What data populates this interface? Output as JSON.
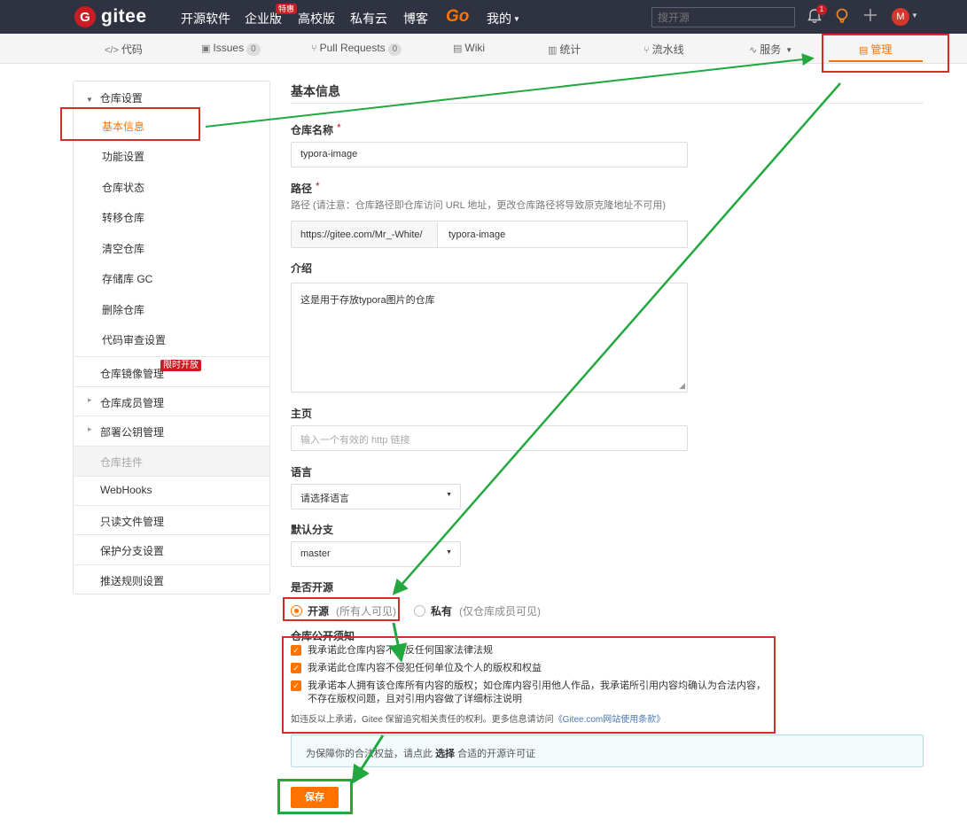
{
  "topnav": {
    "logo_letter": "G",
    "logo_text": "gitee",
    "links": [
      "开源软件",
      "企业版",
      "高校版",
      "私有云",
      "博客"
    ],
    "hot_badge": "特惠",
    "go_label": "Go",
    "mine_label": "我的",
    "search_placeholder": "搜开源",
    "notification_count": "1",
    "avatar_letter": "M",
    "icons": [
      "bell-icon",
      "lightbulb-icon",
      "plus-icon",
      "chevron-down-icon"
    ]
  },
  "tabs": [
    {
      "label": "代码",
      "icon": "code-icon",
      "glyph": "</>"
    },
    {
      "label": "Issues",
      "icon": "issue-icon",
      "glyph": "▣",
      "count": "0"
    },
    {
      "label": "Pull Requests",
      "icon": "pull-request-icon",
      "glyph": "⑂",
      "count": "0"
    },
    {
      "label": "Wiki",
      "icon": "wiki-icon",
      "glyph": "▤"
    },
    {
      "label": "统计",
      "icon": "bar-chart-icon",
      "glyph": "▥"
    },
    {
      "label": "流水线",
      "icon": "pipeline-icon",
      "glyph": "⑂"
    },
    {
      "label": "服务",
      "icon": "pulse-icon",
      "glyph": "∿"
    },
    {
      "label": "管理",
      "icon": "manage-icon",
      "glyph": "▤",
      "active": true
    }
  ],
  "sidebar": {
    "section": "仓库设置",
    "sub_items": [
      "基本信息",
      "功能设置",
      "仓库状态",
      "转移仓库",
      "清空仓库",
      "存储库 GC",
      "删除仓库",
      "代码审查设置"
    ],
    "active_item": "基本信息",
    "groups": [
      "仓库镜像管理",
      "仓库成员管理",
      "部署公钥管理",
      "仓库挂件",
      "WebHooks",
      "只读文件管理",
      "保护分支设置",
      "推送规则设置"
    ],
    "limited_badge": "限时开放"
  },
  "form": {
    "title": "基本信息",
    "name_label": "仓库名称",
    "name_value": "typora-image",
    "path_label": "路径",
    "path_hint": "路径 (请注意：仓库路径即仓库访问 URL 地址，更改仓库路径将导致原克隆地址不可用)",
    "path_prefix": "https://gitee.com/Mr_-White/",
    "path_value": "typora-image",
    "intro_label": "介绍",
    "intro_value": "这是用于存放typora图片的仓库",
    "homepage_label": "主页",
    "homepage_placeholder": "输入一个有效的 http 链接",
    "language_label": "语言",
    "language_value": "请选择语言",
    "branch_label": "默认分支",
    "branch_value": "master",
    "opensource_label": "是否开源",
    "radio_public": "开源",
    "radio_public_note": "(所有人可见)",
    "radio_private": "私有",
    "radio_private_note": "(仅仓库成员可见)",
    "notice_label": "仓库公开须知",
    "checks": [
      "我承诺此仓库内容不违反任何国家法律法规",
      "我承诺此仓库内容不侵犯任何单位及个人的版权和权益",
      "我承诺本人拥有该仓库所有内容的版权；如仓库内容引用他人作品，我承诺所引用内容均确认为合法内容，",
      "不存在版权问题，且对引用内容做了详细标注说明"
    ],
    "fine_print": "如违反以上承诺，Gitee 保留追究相关责任的权利。更多信息请访问",
    "fine_link": "《Gitee.com网站使用条款》",
    "license_notice_pre": "为保障你的合法权益，请点此",
    "license_notice_link": "选择",
    "license_notice_post": "合适的开源许可证",
    "save_label": "保存"
  },
  "colors": {
    "accent": "#fe7300",
    "nav_bg": "#2f3341",
    "annotation_red": "#d62b2b",
    "annotation_green": "#23a840"
  }
}
